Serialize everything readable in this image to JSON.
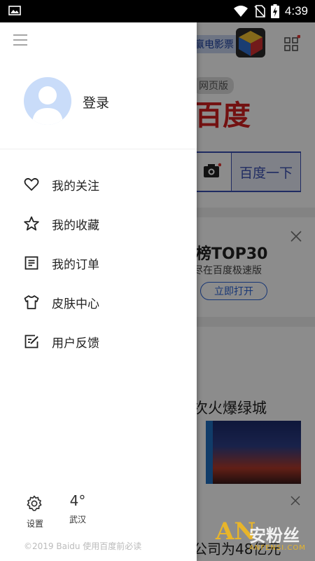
{
  "status_bar": {
    "time": "4:39"
  },
  "background": {
    "movie_tag": "赢电影票",
    "web_version_tag": "网页版",
    "logo_text": "百度",
    "search_button": "百度一下",
    "top_title": "榜TOP30",
    "top_subtitle": "尽在百度极速版",
    "open_button": "立即打开",
    "news_title": "次火爆绿城",
    "bottom_text": "公司为48亿元"
  },
  "watermark": {
    "logo": "AN",
    "cn": "安粉丝",
    "en": "ANFENSI.COM"
  },
  "drawer": {
    "login_label": "登录",
    "menu": [
      {
        "label": "我的关注",
        "icon": "heart-icon"
      },
      {
        "label": "我的收藏",
        "icon": "star-icon"
      },
      {
        "label": "我的订单",
        "icon": "order-list-icon"
      },
      {
        "label": "皮肤中心",
        "icon": "shirt-icon"
      },
      {
        "label": "用户反馈",
        "icon": "feedback-edit-icon"
      }
    ],
    "settings_label": "设置",
    "temperature": "4°",
    "city": "武汉",
    "copyright": "©2019 Baidu 使用百度前必读"
  }
}
